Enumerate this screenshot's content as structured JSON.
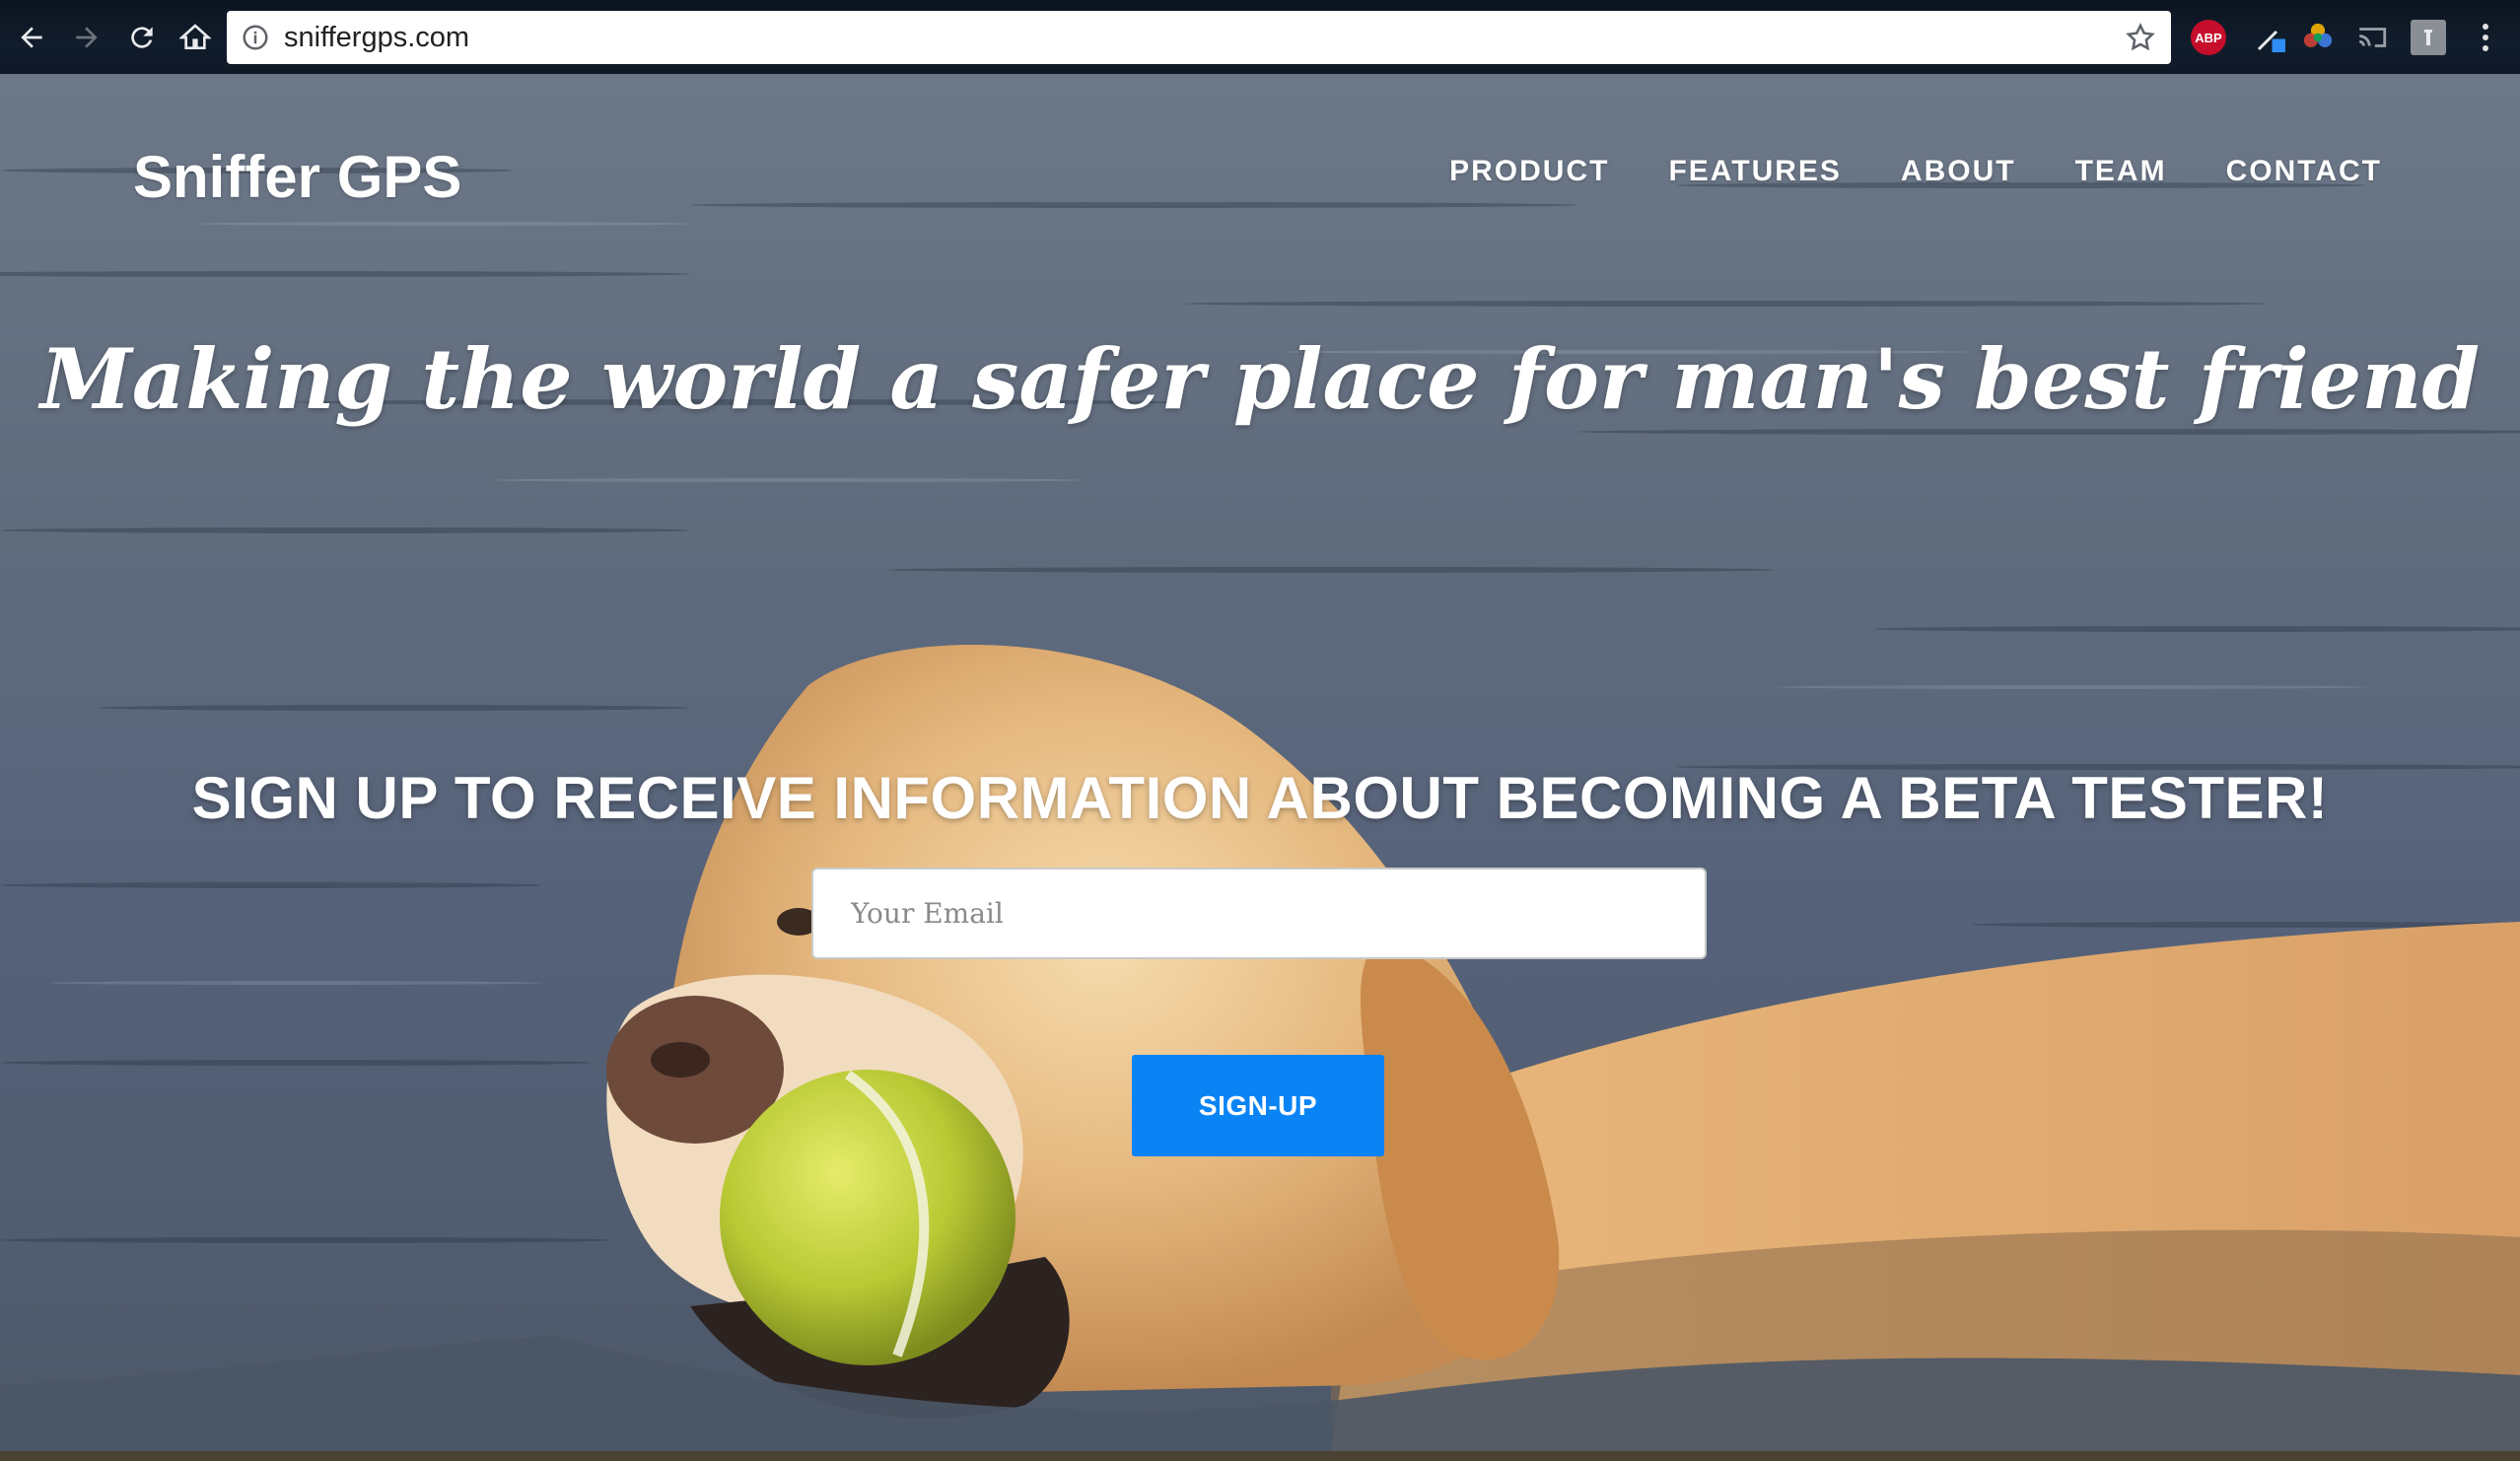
{
  "browser": {
    "url": "sniffergps.com",
    "back_icon": "back-arrow-icon",
    "forward_icon": "forward-arrow-icon",
    "reload_icon": "reload-icon",
    "home_icon": "home-icon",
    "info_icon": "info-icon",
    "bookmark_icon": "star-icon",
    "extensions": {
      "abp_label": "ABP"
    }
  },
  "site": {
    "brand": "Sniffer GPS",
    "nav": [
      "PRODUCT",
      "FEATURES",
      "ABOUT",
      "TEAM",
      "CONTACT"
    ],
    "tagline": "Making the world a safer place for man's best friend",
    "cta_heading": "SIGN UP TO RECEIVE INFORMATION ABOUT BECOMING A BETA TESTER!",
    "email_placeholder": "Your Email",
    "email_value": "",
    "signup_label": "SIGN-UP"
  },
  "colors": {
    "button": "#0a84f5",
    "text": "#ffffff"
  }
}
